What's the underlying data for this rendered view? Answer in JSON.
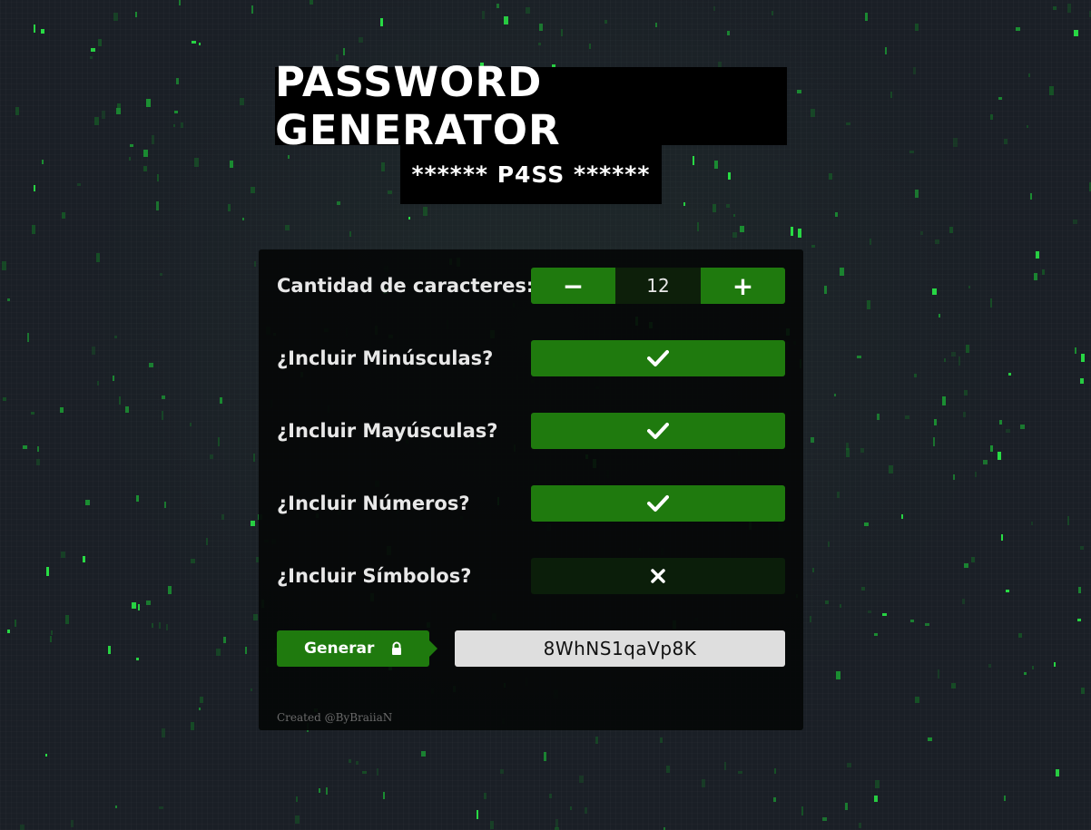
{
  "header": {
    "title": "PASSWORD GENERATOR",
    "subtitle": "****** P4SS ******"
  },
  "length_row": {
    "label": "Cantidad de caracteres:",
    "decrement_symbol": "−",
    "increment_symbol": "+",
    "value": "12"
  },
  "options": [
    {
      "label": "¿Incluir Minúsculas?",
      "state": "on",
      "icon": "check-icon"
    },
    {
      "label": "¿Incluir Mayúsculas?",
      "state": "on",
      "icon": "check-icon"
    },
    {
      "label": "¿Incluir Números?",
      "state": "on",
      "icon": "check-icon"
    },
    {
      "label": "¿Incluir Símbolos?",
      "state": "off",
      "icon": "x-icon"
    }
  ],
  "generate": {
    "label": "Generar",
    "icon": "lock-icon"
  },
  "output": {
    "password": "8WhNS1qaVp8K"
  },
  "footer": {
    "credit": "Created @ByBraiiaN"
  },
  "colors": {
    "accent_green": "#1f7a0e",
    "toggle_off": "#0b1e0a",
    "panel_bg": "#050708",
    "output_bg": "#dedede"
  }
}
